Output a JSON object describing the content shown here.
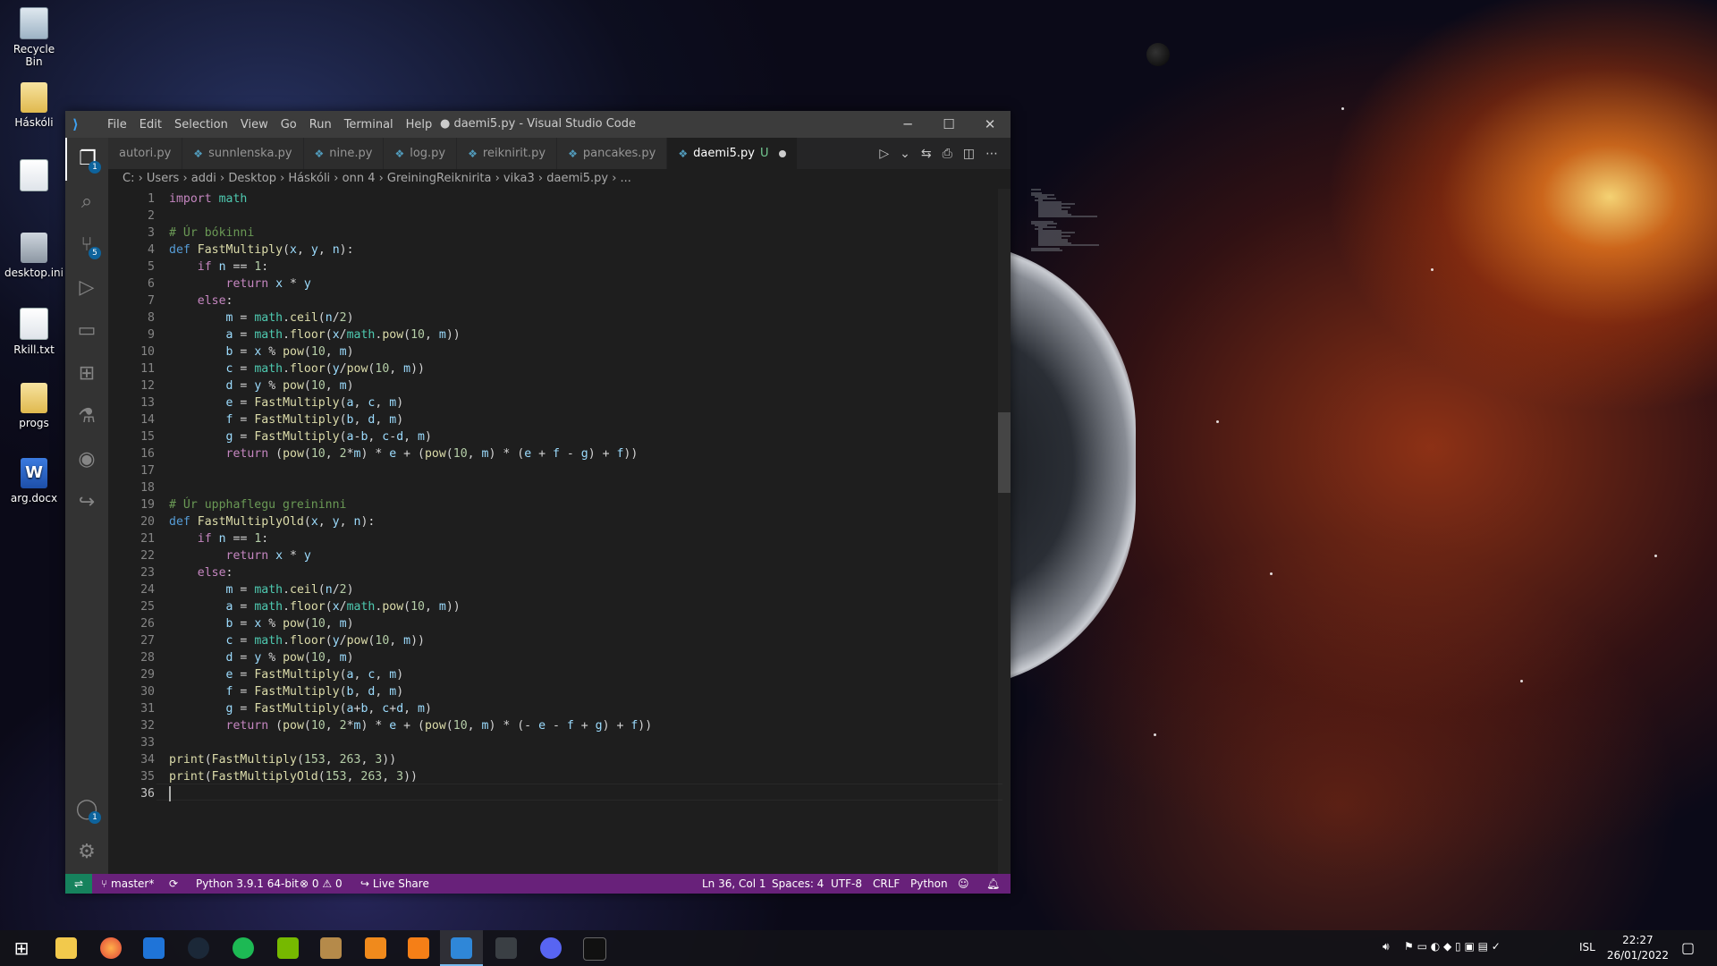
{
  "desktop": {
    "icons": [
      {
        "label": "Recycle Bin",
        "icon": "recycle-bin-icon"
      },
      {
        "label": "Háskóli",
        "icon": "folder-icon"
      },
      {
        "label": "",
        "icon": "file-icon"
      },
      {
        "label": "desktop.ini",
        "icon": "settings-file-icon"
      },
      {
        "label": "Rkill.txt",
        "icon": "text-file-icon"
      },
      {
        "label": "progs",
        "icon": "folder-icon"
      },
      {
        "label": "arg.docx",
        "icon": "word-document-icon"
      }
    ]
  },
  "window": {
    "title": "● daemi5.py - Visual Studio Code",
    "menu": [
      "File",
      "Edit",
      "Selection",
      "View",
      "Go",
      "Run",
      "Terminal",
      "Help"
    ],
    "controls": {
      "minimize": "─",
      "maximize": "☐",
      "close": "✕"
    }
  },
  "activity_bar": {
    "explorer_badge": "1",
    "source_control_badge": "5",
    "accounts_badge": "1"
  },
  "tabs": [
    {
      "label": "autori.py",
      "active": false
    },
    {
      "label": "sunnlenska.py",
      "active": false
    },
    {
      "label": "nine.py",
      "active": false
    },
    {
      "label": "log.py",
      "active": false
    },
    {
      "label": "reiknirit.py",
      "active": false
    },
    {
      "label": "pancakes.py",
      "active": false
    },
    {
      "label": "daemi5.py",
      "active": true,
      "status": "U"
    }
  ],
  "breadcrumb": "C: › Users › addi › Desktop › Háskóli › onn 4 › GreiningReiknirita › vika3 › daemi5.py › ...",
  "editor": {
    "current_line": 36,
    "line_numbers": [
      "1",
      "2",
      "3",
      "4",
      "5",
      "6",
      "7",
      "8",
      "9",
      "10",
      "11",
      "12",
      "13",
      "14",
      "15",
      "16",
      "17",
      "18",
      "19",
      "20",
      "21",
      "22",
      "23",
      "24",
      "25",
      "26",
      "27",
      "28",
      "29",
      "30",
      "31",
      "32",
      "33",
      "34",
      "35",
      "36"
    ],
    "lines": [
      "import math",
      "",
      "# Úr bókinni",
      "def FastMultiply(x, y, n):",
      "    if n == 1:",
      "        return x * y",
      "    else:",
      "        m = math.ceil(n/2)",
      "        a = math.floor(x/math.pow(10, m))",
      "        b = x % pow(10, m)",
      "        c = math.floor(y/pow(10, m))",
      "        d = y % pow(10, m)",
      "        e = FastMultiply(a, c, m)",
      "        f = FastMultiply(b, d, m)",
      "        g = FastMultiply(a-b, c-d, m)",
      "        return (pow(10, 2*m) * e + (pow(10, m) * (e + f - g) + f))",
      "",
      "",
      "# Úr upphaflegu greininni",
      "def FastMultiplyOld(x, y, n):",
      "    if n == 1:",
      "        return x * y",
      "    else:",
      "        m = math.ceil(n/2)",
      "        a = math.floor(x/math.pow(10, m))",
      "        b = x % pow(10, m)",
      "        c = math.floor(y/pow(10, m))",
      "        d = y % pow(10, m)",
      "        e = FastMultiply(a, c, m)",
      "        f = FastMultiply(b, d, m)",
      "        g = FastMultiply(a+b, c+d, m)",
      "        return (pow(10, 2*m) * e + (pow(10, m) * (- e - f + g) + f))",
      "",
      "print(FastMultiply(153, 263, 3))",
      "print(FastMultiplyOld(153, 263, 3))",
      ""
    ]
  },
  "status_bar": {
    "branch": "master*",
    "interpreter": "Python 3.9.1 64-bit",
    "errors": "0",
    "warnings": "0",
    "live_share": "Live Share",
    "position": "Ln 36, Col 1",
    "spaces": "Spaces: 4",
    "encoding": "UTF-8",
    "eol": "CRLF",
    "language": "Python"
  },
  "taskbar": {
    "language": "ISL",
    "time": "22:27",
    "date": "26/01/2022"
  },
  "colors": {
    "status_bar": "#68217a",
    "remote_indicator": "#16825d",
    "editor_bg": "#1e1e1e",
    "accent": "#0e639c"
  }
}
